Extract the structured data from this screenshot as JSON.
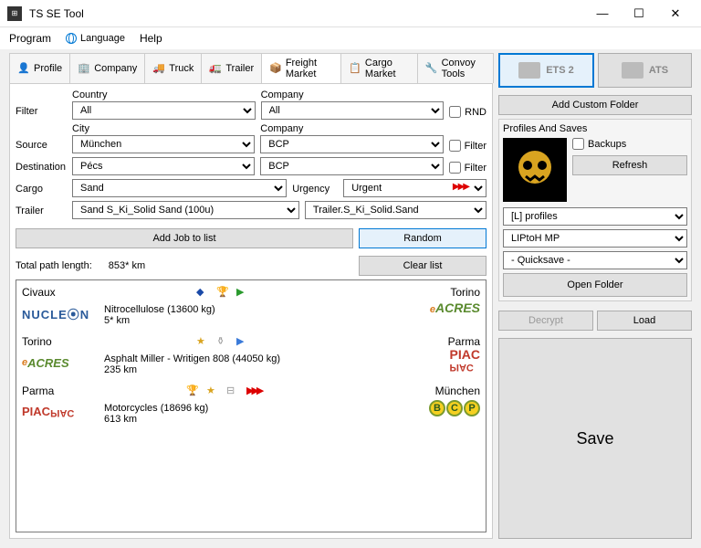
{
  "window": {
    "title": "TS SE Tool"
  },
  "menu": {
    "program": "Program",
    "language": "Language",
    "help": "Help"
  },
  "tabs": [
    {
      "label": "Profile"
    },
    {
      "label": "Company"
    },
    {
      "label": "Truck"
    },
    {
      "label": "Trailer"
    },
    {
      "label": "Freight Market"
    },
    {
      "label": "Cargo Market"
    },
    {
      "label": "Convoy Tools"
    }
  ],
  "games": {
    "ets2": "ETS 2",
    "ats": "ATS"
  },
  "right": {
    "addFolder": "Add Custom Folder",
    "profilesHeader": "Profiles And Saves",
    "backups": "Backups",
    "refresh": "Refresh",
    "profileSel": "[L] profiles",
    "profileName": "LIPtoH MP",
    "saveName": "- Quicksave -",
    "openFolder": "Open Folder",
    "decrypt": "Decrypt",
    "load": "Load",
    "save": "Save"
  },
  "form": {
    "filterLbl": "Filter",
    "sourceLbl": "Source",
    "destLbl": "Destination",
    "cargoLbl": "Cargo",
    "trailerLbl": "Trailer",
    "urgencyLbl": "Urgency",
    "countryLbl": "Country",
    "companyLbl": "Company",
    "cityLbl": "City",
    "country": "All",
    "company1": "All",
    "city": "München",
    "company2": "BCP",
    "destCity": "Pécs",
    "destCompany": "BCP",
    "cargo": "Sand",
    "urgency": "Urgent",
    "trailer": "Sand S_Ki_Solid Sand (100u)",
    "trailerDef": "Trailer.S_Ki_Solid.Sand",
    "rnd": "RND",
    "filterChk": "Filter",
    "addJob": "Add Job to list",
    "random": "Random",
    "pathLbl": "Total path length:",
    "pathVal": "853* km",
    "clear": "Clear list"
  },
  "jobs": [
    {
      "from": "Civaux",
      "fromCo": "NUCLEON",
      "cargo": "Nitrocellulose (13600 kg)",
      "dist": "5* km",
      "to": "Torino",
      "toCo": "eACRES"
    },
    {
      "from": "Torino",
      "fromCo": "eACRES",
      "cargo": "Asphalt Miller - Writigen 808 (44050 kg)",
      "dist": "235 km",
      "to": "Parma",
      "toCo": "PIAC"
    },
    {
      "from": "Parma",
      "fromCo": "PIAC",
      "cargo": "Motorcycles (18696 kg)",
      "dist": "613 km",
      "to": "München",
      "toCo": "BCP"
    }
  ]
}
